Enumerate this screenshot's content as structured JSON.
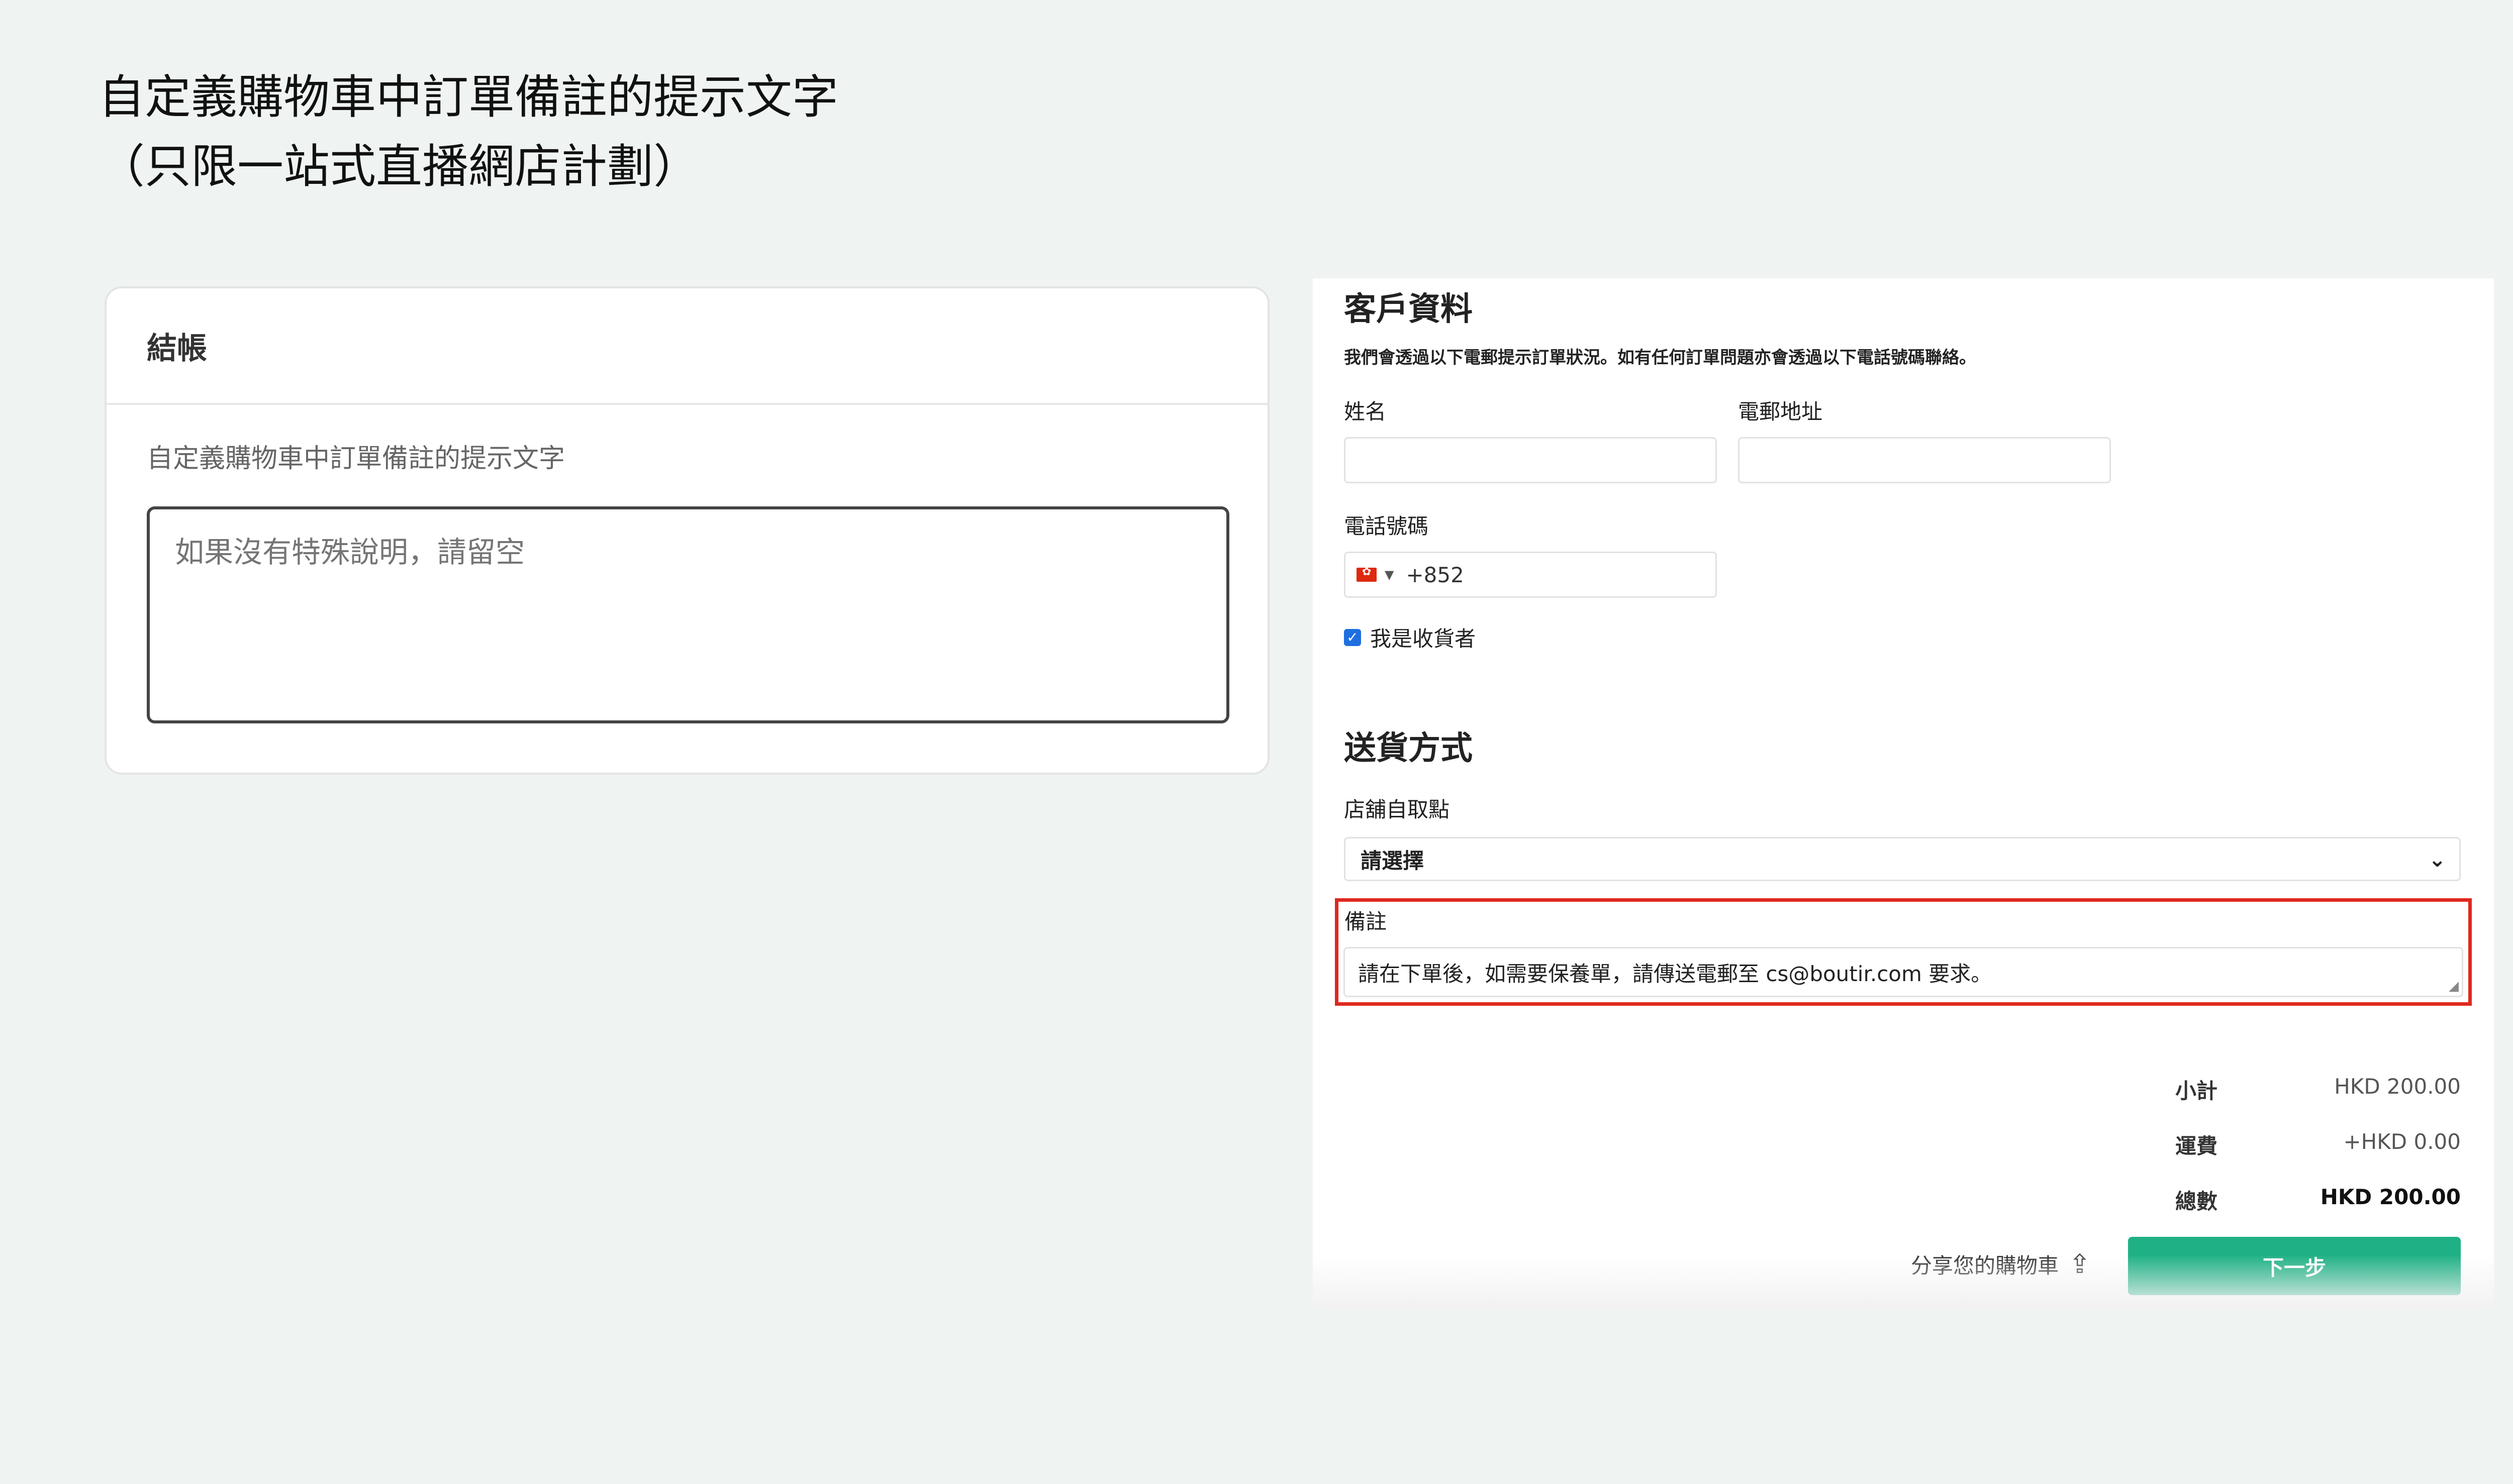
{
  "slide": {
    "title_line1": "自定義購物車中訂單備註的提示文字",
    "title_line2": "（只限一站式直播網店計劃）"
  },
  "checkout_settings": {
    "card_title": "結帳",
    "field_label": "自定義購物車中訂單備註的提示文字",
    "placeholder": "如果沒有特殊說明，請留空"
  },
  "cart": {
    "customer_heading": "客戶資料",
    "customer_note": "我們會透過以下電郵提示訂單狀況。如有任何訂單問題亦會透過以下電話號碼聯絡。",
    "name_label": "姓名",
    "email_label": "電郵地址",
    "phone_label": "電話號碼",
    "phone_code": "+852",
    "recipient_label": "我是收貨者",
    "recipient_checked": true,
    "delivery_heading": "送貨方式",
    "pickup_label": "店舖自取點",
    "pickup_selected": "請選擇",
    "remark_label": "備註",
    "remark_value": "請在下單後，如需要保養單，請傳送電郵至 cs@boutir.com 要求。",
    "subtotal_label": "小計",
    "subtotal_value": "HKD 200.00",
    "shipping_label": "運費",
    "shipping_value": "+HKD 0.00",
    "total_label": "總數",
    "total_value": "HKD 200.00",
    "share_label": "分享您的購物車",
    "next_button": "下一步"
  },
  "colors": {
    "accent_green": "#1fb185",
    "highlight_red": "#e0281e",
    "checkbox_blue": "#1e6fe0"
  },
  "icons": {
    "share": "share-icon",
    "dropdown": "chevron-down-icon",
    "flag": "hk-flag-icon"
  }
}
